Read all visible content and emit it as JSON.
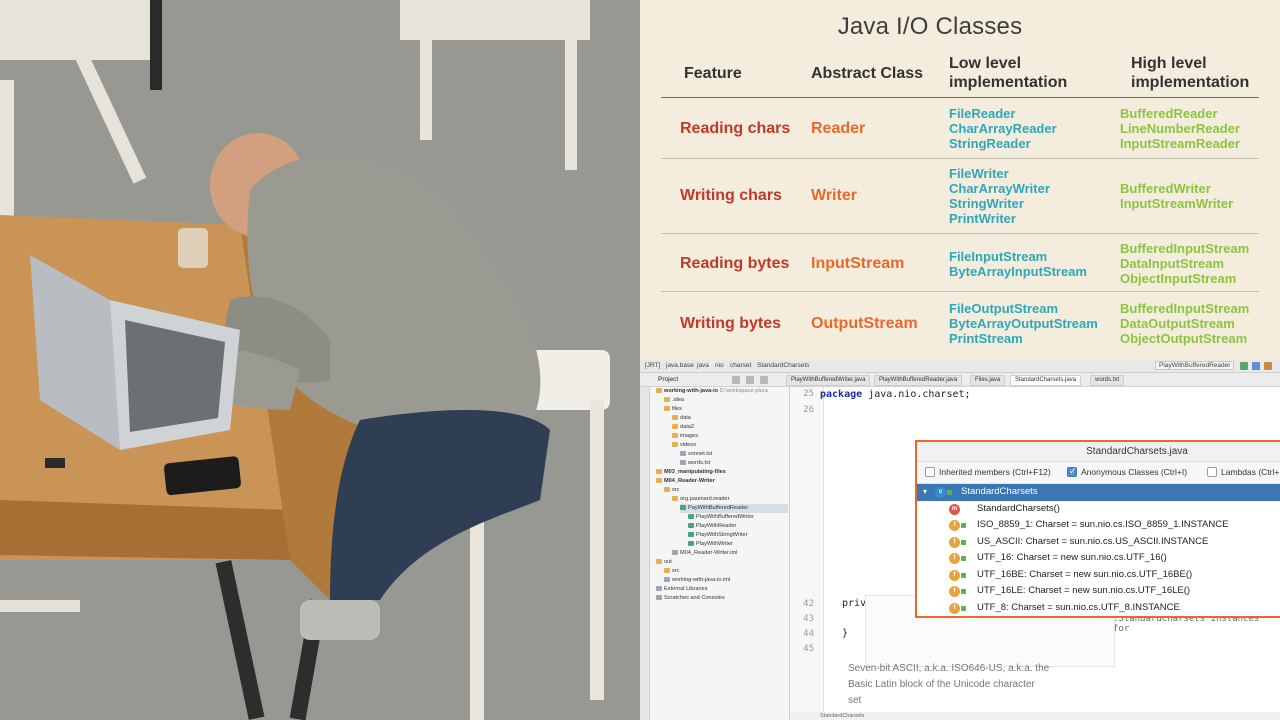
{
  "slide": {
    "title": "Java I/O Classes",
    "headers": {
      "feature": "Feature",
      "abstract": "Abstract Class",
      "low": [
        "Low level",
        "implementation"
      ],
      "high": [
        "High level",
        "implementation"
      ]
    },
    "rows": [
      {
        "feature": "Reading chars",
        "abstract": "Reader",
        "low": [
          "FileReader",
          "CharArrayReader",
          "StringReader"
        ],
        "high": [
          "BufferedReader",
          "LineNumberReader",
          "InputStreamReader"
        ]
      },
      {
        "feature": "Writing chars",
        "abstract": "Writer",
        "low": [
          "FileWriter",
          "CharArrayWriter",
          "StringWriter",
          "PrintWriter"
        ],
        "high": [
          "BufferedWriter",
          "InputStreamWriter"
        ]
      },
      {
        "feature": "Reading bytes",
        "abstract": "InputStream",
        "low": [
          "FileInputStream",
          "ByteArrayInputStream"
        ],
        "high": [
          "BufferedInputStream",
          "DataInputStream",
          "ObjectInputStream"
        ]
      },
      {
        "feature": "Writing bytes",
        "abstract": "OutputStream",
        "low": [
          "FileOutputStream",
          "ByteArrayOutputStream",
          "PrintStream"
        ],
        "high": [
          "BufferedInputStream",
          "DataOutputStream",
          "ObjectOutputStream"
        ]
      }
    ],
    "colors": {
      "feature": "#c0392b",
      "abstract": "#e8692c",
      "low": "#2ea7b9",
      "high": "#8bc53f"
    }
  },
  "ide": {
    "breadcrumbs": [
      "[JRT]",
      "java.base",
      "java",
      "nio",
      "charset",
      "StandardCharsets"
    ],
    "run_config": "PlayWithBufferedReader",
    "project_label": "Project",
    "tabs": [
      "PlayWithBufferedWriter.java",
      "PlayWithBufferedReader.java",
      "Files.java",
      "StandardCharsets.java",
      "words.txt"
    ],
    "active_tab": "StandardCharsets.java",
    "tree": [
      "working-with-java-io",
      ".idea",
      "files",
      "data",
      "data2",
      "images",
      "videos",
      "sonnet.txt",
      "words.txt",
      "M03_manipulating-files",
      "M04_Reader-Writer",
      "src",
      "org.paumard.reader",
      "PayWithBufferedReader",
      "PlayWithBufferedWriter",
      "PlayWithReader",
      "PlayWithStringWriter",
      "PlayWithWriter",
      "M04_Reader-Writer.iml",
      "out",
      "src",
      "working-with-java-io.iml",
      "External Libraries",
      "Scratches and Consoles"
    ],
    "tree_root_suffix": "D:\\workspace-plura",
    "line_numbers": [
      "25",
      "26",
      "42",
      "43",
      "44",
      "45"
    ],
    "code": {
      "package_kw": "package",
      "package_name": "java.nio.charset;",
      "priv": "priv",
      "brace": "}",
      "ghost_instances": ".StandardCharsets instances for",
      "ghost_ts": "ts",
      "ghost_eding": "eding"
    },
    "doc_text": [
      "Seven-bit ASCII, a.k.a. ISO646-US, a.k.a. the",
      "Basic Latin block of the Unicode character",
      "set"
    ],
    "bottom_status": "StandardCharsets",
    "popup": {
      "title": "StandardCharsets.java",
      "options": [
        {
          "label": "Inherited members (Ctrl+F12)",
          "checked": false
        },
        {
          "label": "Anonymous Classes (Ctrl+I)",
          "checked": true
        },
        {
          "label": "Lambdas (Ctrl+L)",
          "checked": false
        }
      ],
      "items": [
        {
          "kind": "class",
          "text": "StandardCharsets"
        },
        {
          "kind": "method",
          "text": "StandardCharsets()"
        },
        {
          "kind": "field",
          "text": "ISO_8859_1: Charset = sun.nio.cs.ISO_8859_1.INSTANCE"
        },
        {
          "kind": "field",
          "text": "US_ASCII: Charset = sun.nio.cs.US_ASCII.INSTANCE"
        },
        {
          "kind": "field",
          "text": "UTF_16: Charset = new sun.nio.cs.UTF_16()"
        },
        {
          "kind": "field",
          "text": "UTF_16BE: Charset = new sun.nio.cs.UTF_16BE()"
        },
        {
          "kind": "field",
          "text": "UTF_16LE: Charset = new sun.nio.cs.UTF_16LE()"
        },
        {
          "kind": "field",
          "text": "UTF_8: Charset = sun.nio.cs.UTF_8.INSTANCE"
        }
      ]
    }
  }
}
